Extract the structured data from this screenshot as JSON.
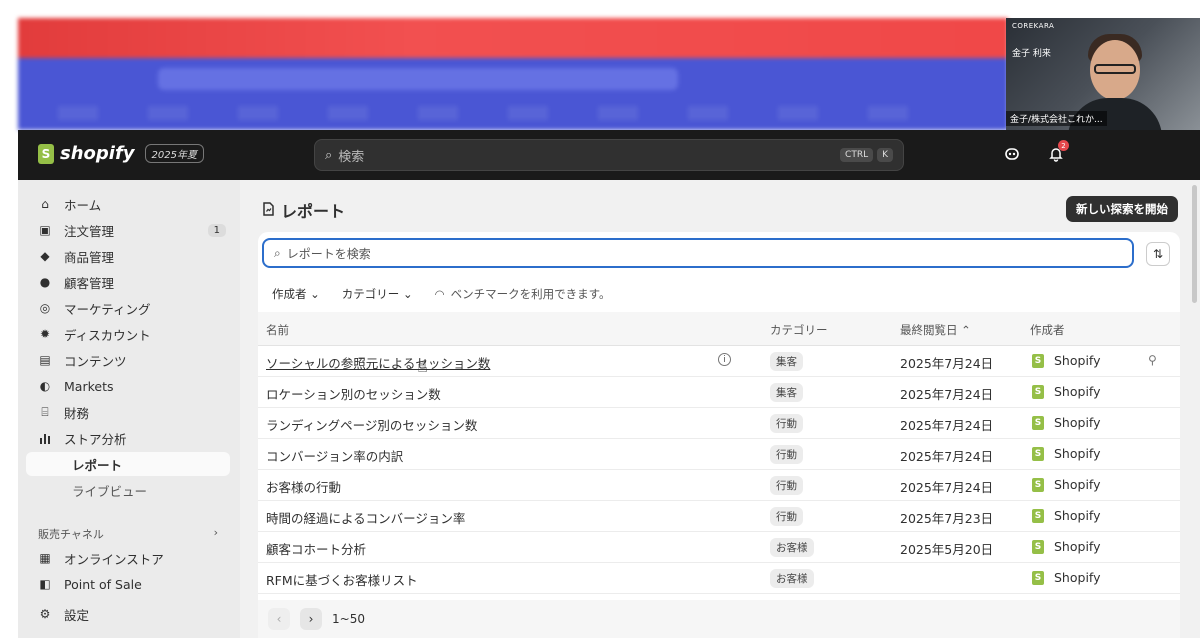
{
  "webcam": {
    "brand": "COREKARA",
    "name": "金子 利来",
    "caption": "金子/株式会社これか..."
  },
  "topbar": {
    "logo_text": "shopify",
    "edition": "2025年夏",
    "search_placeholder": "検索",
    "shortcut_1": "CTRL",
    "shortcut_2": "K",
    "notification_count": "2"
  },
  "sidebar": {
    "home": "ホーム",
    "orders": "注文管理",
    "orders_count": "1",
    "products": "商品管理",
    "customers": "顧客管理",
    "marketing": "マーケティング",
    "discounts": "ディスカウント",
    "content": "コンテンツ",
    "markets": "Markets",
    "finance": "財務",
    "analytics": "ストア分析",
    "reports": "レポート",
    "live_view": "ライブビュー",
    "sales_channels": "販売チャネル",
    "online_store": "オンラインストア",
    "pos": "Point of Sale",
    "settings": "設定"
  },
  "main": {
    "title": "レポート",
    "new_button": "新しい探索を開始",
    "search_placeholder": "レポートを検索",
    "filter_creator": "作成者",
    "filter_category": "カテゴリー",
    "benchmark_text": "ベンチマークを利用できます。",
    "columns": {
      "name": "名前",
      "category": "カテゴリー",
      "last_viewed": "最終閲覧日",
      "creator": "作成者"
    },
    "rows": [
      {
        "name": "ソーシャルの参照元によるセッション数",
        "category": "集客",
        "date": "2025年7月24日",
        "creator": "Shopify"
      },
      {
        "name": "ロケーション別のセッション数",
        "category": "集客",
        "date": "2025年7月24日",
        "creator": "Shopify"
      },
      {
        "name": "ランディングページ別のセッション数",
        "category": "行動",
        "date": "2025年7月24日",
        "creator": "Shopify"
      },
      {
        "name": "コンバージョン率の内訳",
        "category": "行動",
        "date": "2025年7月24日",
        "creator": "Shopify"
      },
      {
        "name": "お客様の行動",
        "category": "行動",
        "date": "2025年7月24日",
        "creator": "Shopify"
      },
      {
        "name": "時間の経過によるコンバージョン率",
        "category": "行動",
        "date": "2025年7月23日",
        "creator": "Shopify"
      },
      {
        "name": "顧客コホート分析",
        "category": "お客様",
        "date": "2025年5月20日",
        "creator": "Shopify"
      },
      {
        "name": "RFMに基づくお客様リスト",
        "category": "お客様",
        "date": "",
        "creator": "Shopify"
      }
    ],
    "pagination": "1~50"
  }
}
